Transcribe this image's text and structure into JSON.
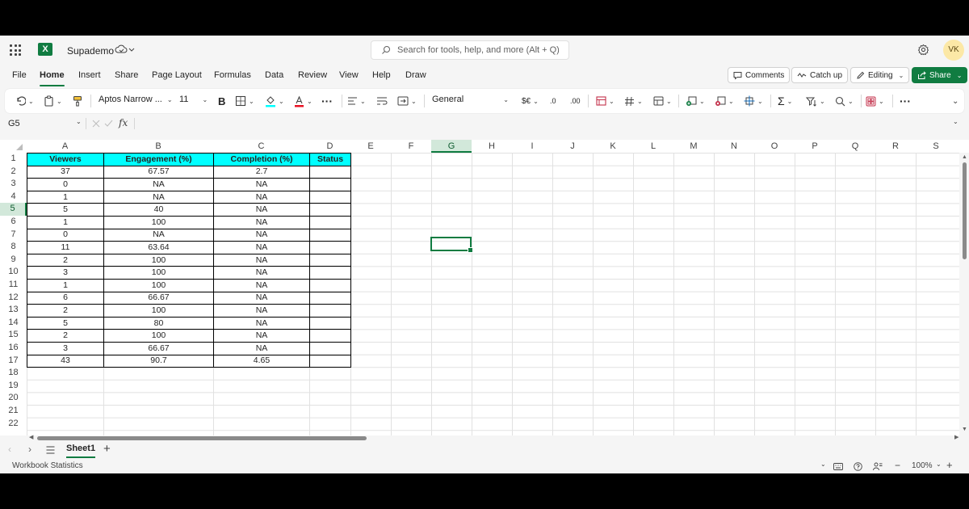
{
  "app": {
    "doc_title": "Supademo",
    "search_placeholder": "Search for tools, help, and more (Alt + Q)",
    "avatar_initials": "VK",
    "accent": "#107c41",
    "header_fill": "#00ffff"
  },
  "menu": {
    "tabs": [
      "File",
      "Home",
      "Insert",
      "Share",
      "Page Layout",
      "Formulas",
      "Data",
      "Review",
      "View",
      "Help",
      "Draw"
    ],
    "active": "Home",
    "comments": "Comments",
    "catch_up": "Catch up",
    "editing": "Editing",
    "share": "Share"
  },
  "ribbon": {
    "font_name": "Aptos Narrow ...",
    "font_size": "11",
    "bold": "B",
    "number_format": "General",
    "currency": "$€",
    "dec_less": ".0",
    "dec_more": ".00",
    "more": "···"
  },
  "formula_bar": {
    "name_box": "G5",
    "fx": "fx",
    "content": ""
  },
  "grid": {
    "columns": [
      "A",
      "B",
      "C",
      "D",
      "E",
      "F",
      "G",
      "H",
      "I",
      "J",
      "K",
      "L",
      "M",
      "N",
      "O",
      "P",
      "Q",
      "R",
      "S"
    ],
    "selected_col": "G",
    "rows": [
      "1",
      "2",
      "3",
      "4",
      "5",
      "6",
      "7",
      "8",
      "9",
      "10",
      "11",
      "12",
      "13",
      "14",
      "15",
      "16",
      "17",
      "18",
      "19",
      "20",
      "21",
      "22"
    ],
    "selected_row": "5",
    "headers": [
      "Viewers",
      "Engagement (%)",
      "Completion (%)",
      "Status"
    ],
    "data": [
      [
        "37",
        "67.57",
        "2.7",
        ""
      ],
      [
        "0",
        "NA",
        "NA",
        ""
      ],
      [
        "1",
        "NA",
        "NA",
        ""
      ],
      [
        "5",
        "40",
        "NA",
        ""
      ],
      [
        "1",
        "100",
        "NA",
        ""
      ],
      [
        "0",
        "NA",
        "NA",
        ""
      ],
      [
        "11",
        "63.64",
        "NA",
        ""
      ],
      [
        "2",
        "100",
        "NA",
        ""
      ],
      [
        "3",
        "100",
        "NA",
        ""
      ],
      [
        "1",
        "100",
        "NA",
        ""
      ],
      [
        "6",
        "66.67",
        "NA",
        ""
      ],
      [
        "2",
        "100",
        "NA",
        ""
      ],
      [
        "5",
        "80",
        "NA",
        ""
      ],
      [
        "2",
        "100",
        "NA",
        ""
      ],
      [
        "3",
        "66.67",
        "NA",
        ""
      ],
      [
        "43",
        "90.7",
        "4.65",
        ""
      ]
    ]
  },
  "sheets": {
    "active": "Sheet1",
    "add": "+"
  },
  "status": {
    "left": "Workbook Statistics",
    "zoom": "100%",
    "minus": "−",
    "plus": "+"
  }
}
